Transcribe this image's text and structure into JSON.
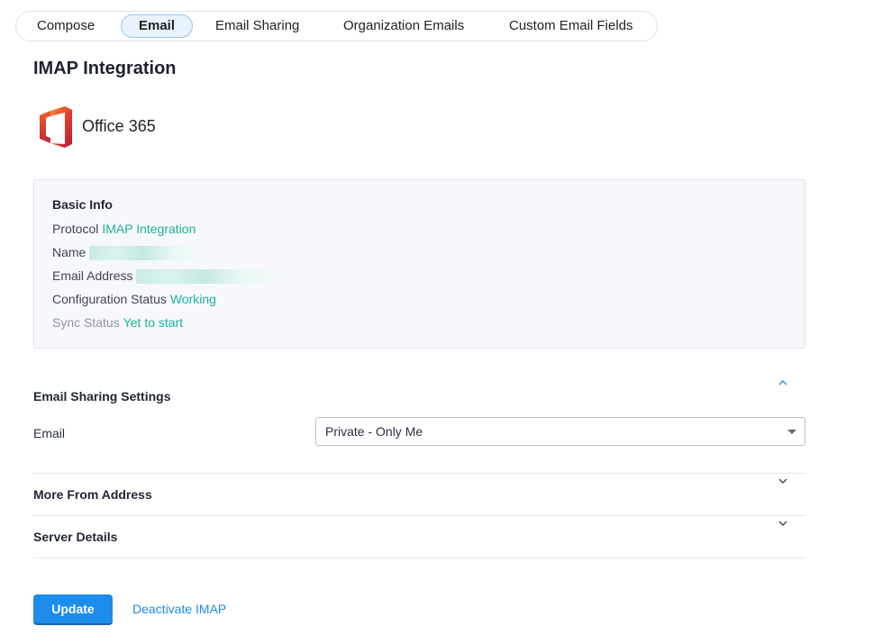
{
  "tabs": [
    {
      "label": "Compose",
      "active": false
    },
    {
      "label": "Email",
      "active": true
    },
    {
      "label": "Email Sharing",
      "active": false
    },
    {
      "label": "Organization Emails",
      "active": false
    },
    {
      "label": "Custom Email Fields",
      "active": false
    }
  ],
  "page_title": "IMAP Integration",
  "provider": {
    "name": "Office 365",
    "icon": "office365-logo-icon"
  },
  "basic_info": {
    "title": "Basic Info",
    "protocol_label": "Protocol",
    "protocol_value": "IMAP Integration",
    "name_label": "Name",
    "email_label": "Email Address",
    "config_status_label": "Configuration Status",
    "config_status_value": "Working",
    "sync_status_label": "Sync Status",
    "sync_status_value": "Yet to start"
  },
  "email_sharing": {
    "title": "Email Sharing Settings",
    "field_label": "Email",
    "selected": "Private - Only Me",
    "icon": "chevron-up-icon"
  },
  "sections": [
    {
      "title": "More From Address",
      "icon": "chevron-down-icon"
    },
    {
      "title": "Server Details",
      "icon": "chevron-down-icon"
    }
  ],
  "actions": {
    "update_label": "Update",
    "deactivate_label": "Deactivate IMAP"
  },
  "colors": {
    "accent": "#1d8ceb",
    "status_green": "#1fb19b",
    "info_bg": "#f6f8fc"
  }
}
